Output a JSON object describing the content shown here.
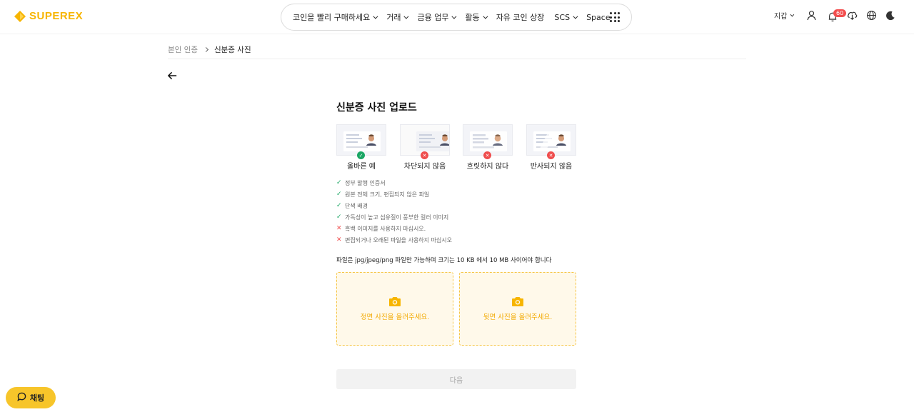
{
  "header": {
    "logo_text": "SUPEREX",
    "nav": [
      {
        "label": "코인을 빨리 구매하세요",
        "has_dropdown": true
      },
      {
        "label": "거래",
        "has_dropdown": true
      },
      {
        "label": "금융 업무",
        "has_dropdown": true
      },
      {
        "label": "활동",
        "has_dropdown": true
      },
      {
        "label": "자유 코인 상장",
        "has_dropdown": false
      },
      {
        "label": "SCS",
        "has_dropdown": true
      },
      {
        "label": "Space",
        "has_dropdown": false
      }
    ],
    "wallet_label": "지갑",
    "notification_count": "60",
    "icons": [
      "user-icon",
      "bell-icon",
      "download-icon",
      "globe-icon",
      "moon-icon"
    ]
  },
  "breadcrumb": {
    "parent": "본인 인증",
    "current": "신분증 사진"
  },
  "main": {
    "title": "신분증 사진 업로드",
    "examples": [
      {
        "label": "올바른 예",
        "status": "ok"
      },
      {
        "label": "차단되지 않음",
        "status": "bad"
      },
      {
        "label": "흐릿하지 않다",
        "status": "bad"
      },
      {
        "label": "반사되지 않음",
        "status": "bad"
      }
    ],
    "rules": [
      {
        "text": "정부 발행 인증서",
        "ok": true
      },
      {
        "text": "원본 전체 크기, 편집되지 않은 파일",
        "ok": true
      },
      {
        "text": "단색 배경",
        "ok": true
      },
      {
        "text": "가독성이 높고 섬유질이 풍부한 컬러 이미지",
        "ok": true
      },
      {
        "text": "흑백 이미지를 사용하지 마십시오.",
        "ok": false
      },
      {
        "text": "편집되거나 오래된 파일을 사용하지 마십시오",
        "ok": false
      }
    ],
    "file_note": "파일은 jpg/jpeg/png 파일만 가능하며 크기는 10 KB 에서 10 MB 사이어야 합니다",
    "upload_front": "정면 사진을 올려주세요.",
    "upload_back": "뒷면 사진을 올려주세요.",
    "next_label": "다음"
  },
  "chat": {
    "label": "채팅"
  },
  "colors": {
    "accent": "#F7B500",
    "ok": "#1aa664",
    "bad": "#ef4d4d",
    "upload_bg": "#fff9ea"
  }
}
